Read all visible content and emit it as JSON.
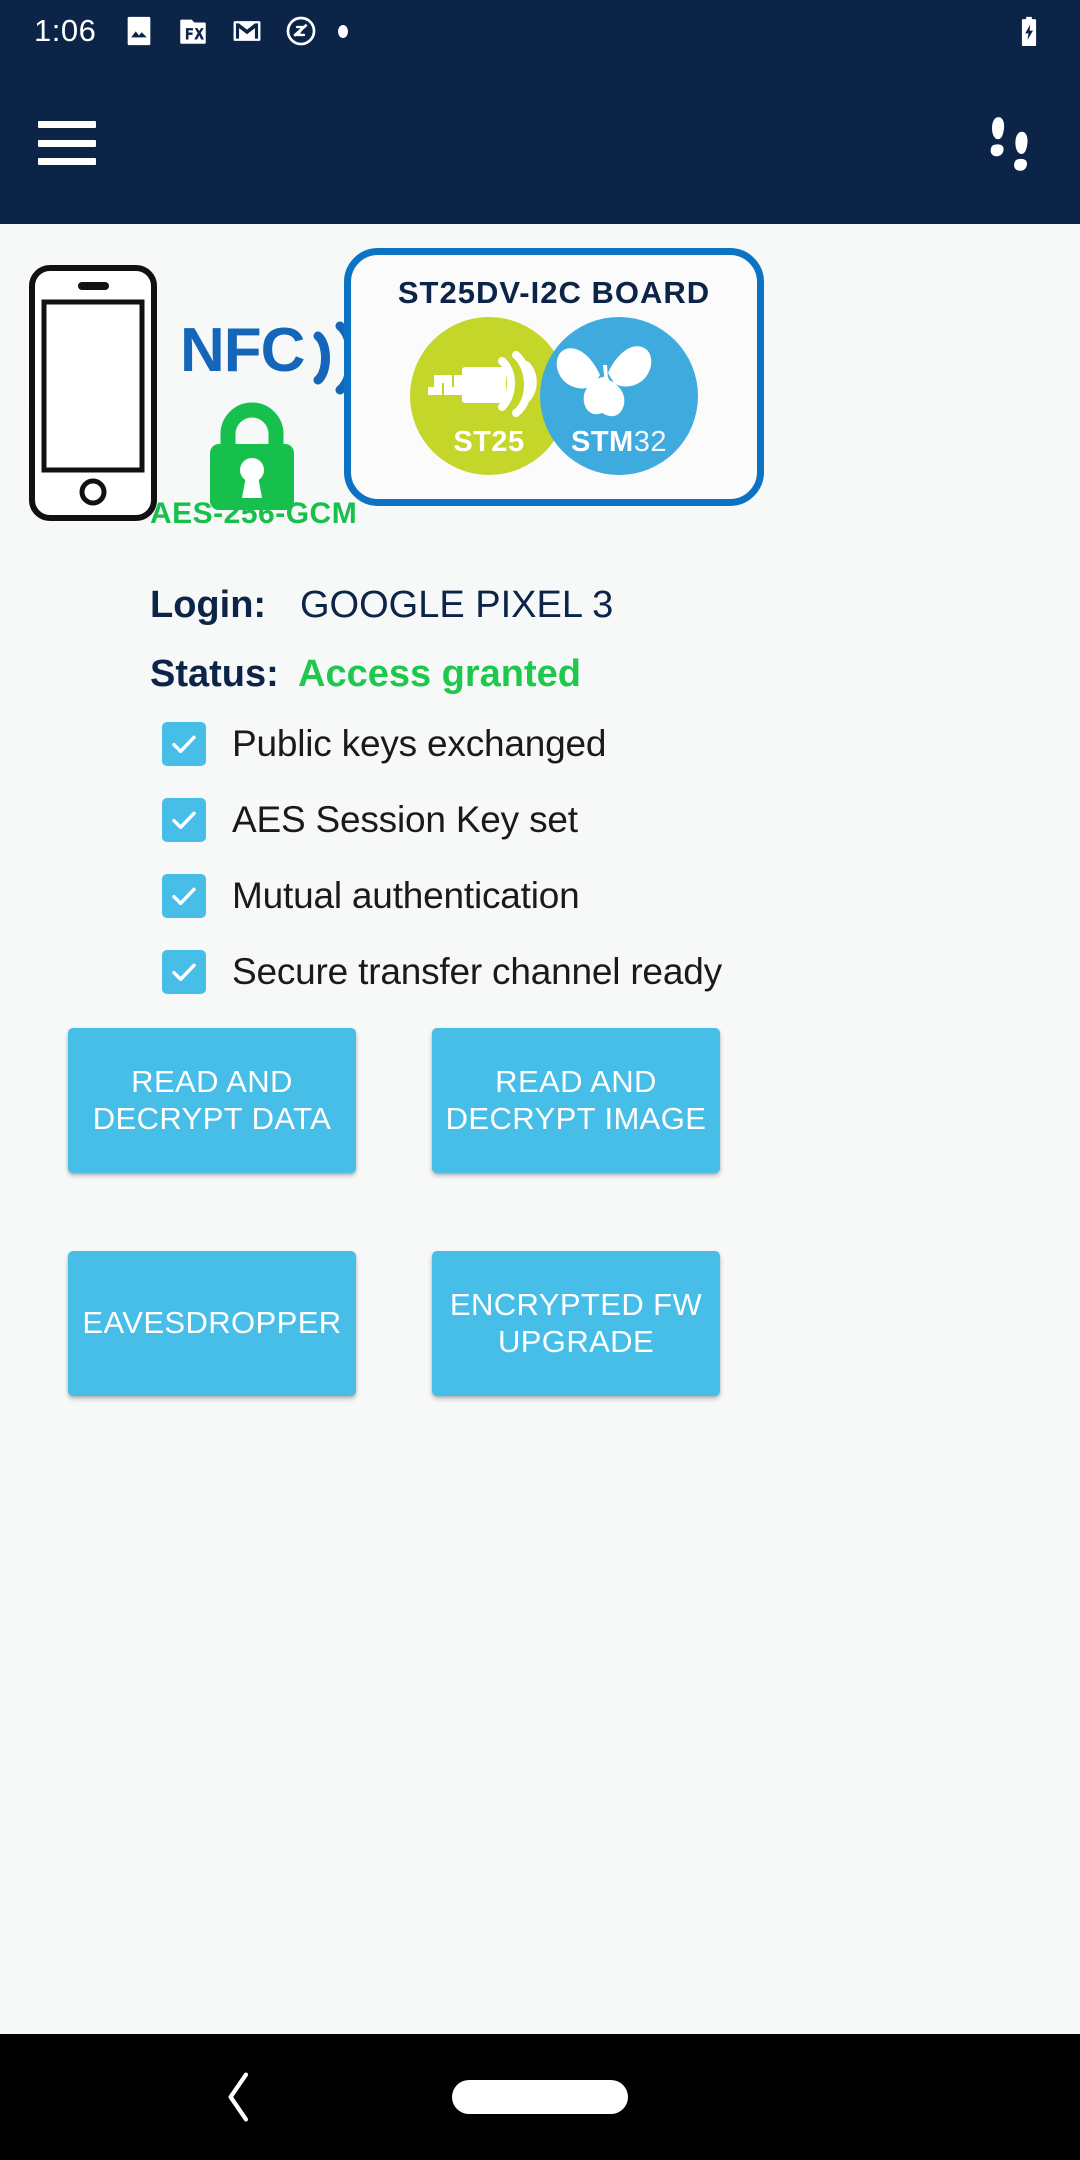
{
  "statusbar": {
    "time": "1:06",
    "icons": [
      "photos-icon",
      "file-explorer-icon",
      "gmail-icon",
      "do-not-disturb-icon",
      "notification-dot-icon"
    ],
    "battery": "battery-charging-icon"
  },
  "appbar": {
    "menu": "hamburger-menu-icon",
    "action": "footprints-icon",
    "background": "#0b2447"
  },
  "hero": {
    "phone": "smartphone-outline-icon",
    "nfc_label": "NFC",
    "nfc_wave": "nfc-wave-icon",
    "lock": "padlock-icon",
    "aes_label": "AES-256-GCM",
    "board_title": "ST25DV-I2C BOARD",
    "logos": [
      {
        "name": "st25-logo",
        "text_bold": "ST25",
        "text_thin": "",
        "color": "#c4d62a"
      },
      {
        "name": "stm32-logo",
        "text_bold": "STM",
        "text_thin": "32",
        "color": "#3faadd"
      }
    ],
    "colors": {
      "nfc_blue": "#1565b8",
      "lock_green": "#17c04d",
      "card_border": "#0b72c4"
    }
  },
  "info": {
    "login_label": "Login:",
    "login_value": "GOOGLE PIXEL 3",
    "status_label": "Status:",
    "status_value": "Access granted",
    "status_color": "#1ec84d"
  },
  "checklist": [
    {
      "label": "Public keys exchanged",
      "checked": true
    },
    {
      "label": "AES Session Key set",
      "checked": true
    },
    {
      "label": "Mutual authentication",
      "checked": true
    },
    {
      "label": "Secure transfer channel ready",
      "checked": true
    }
  ],
  "buttons": [
    {
      "label": "READ AND DECRYPT DATA",
      "name": "read-decrypt-data-button"
    },
    {
      "label": "READ AND DECRYPT IMAGE",
      "name": "read-decrypt-image-button"
    },
    {
      "label": "EAVESDROPPER",
      "name": "eavesdropper-button"
    },
    {
      "label": "ENCRYPTED FW UPGRADE",
      "name": "encrypted-fw-upgrade-button"
    }
  ],
  "button_color": "#47bee8",
  "navbar": {
    "back": "back-chevron-icon",
    "home": "home-pill-icon"
  }
}
